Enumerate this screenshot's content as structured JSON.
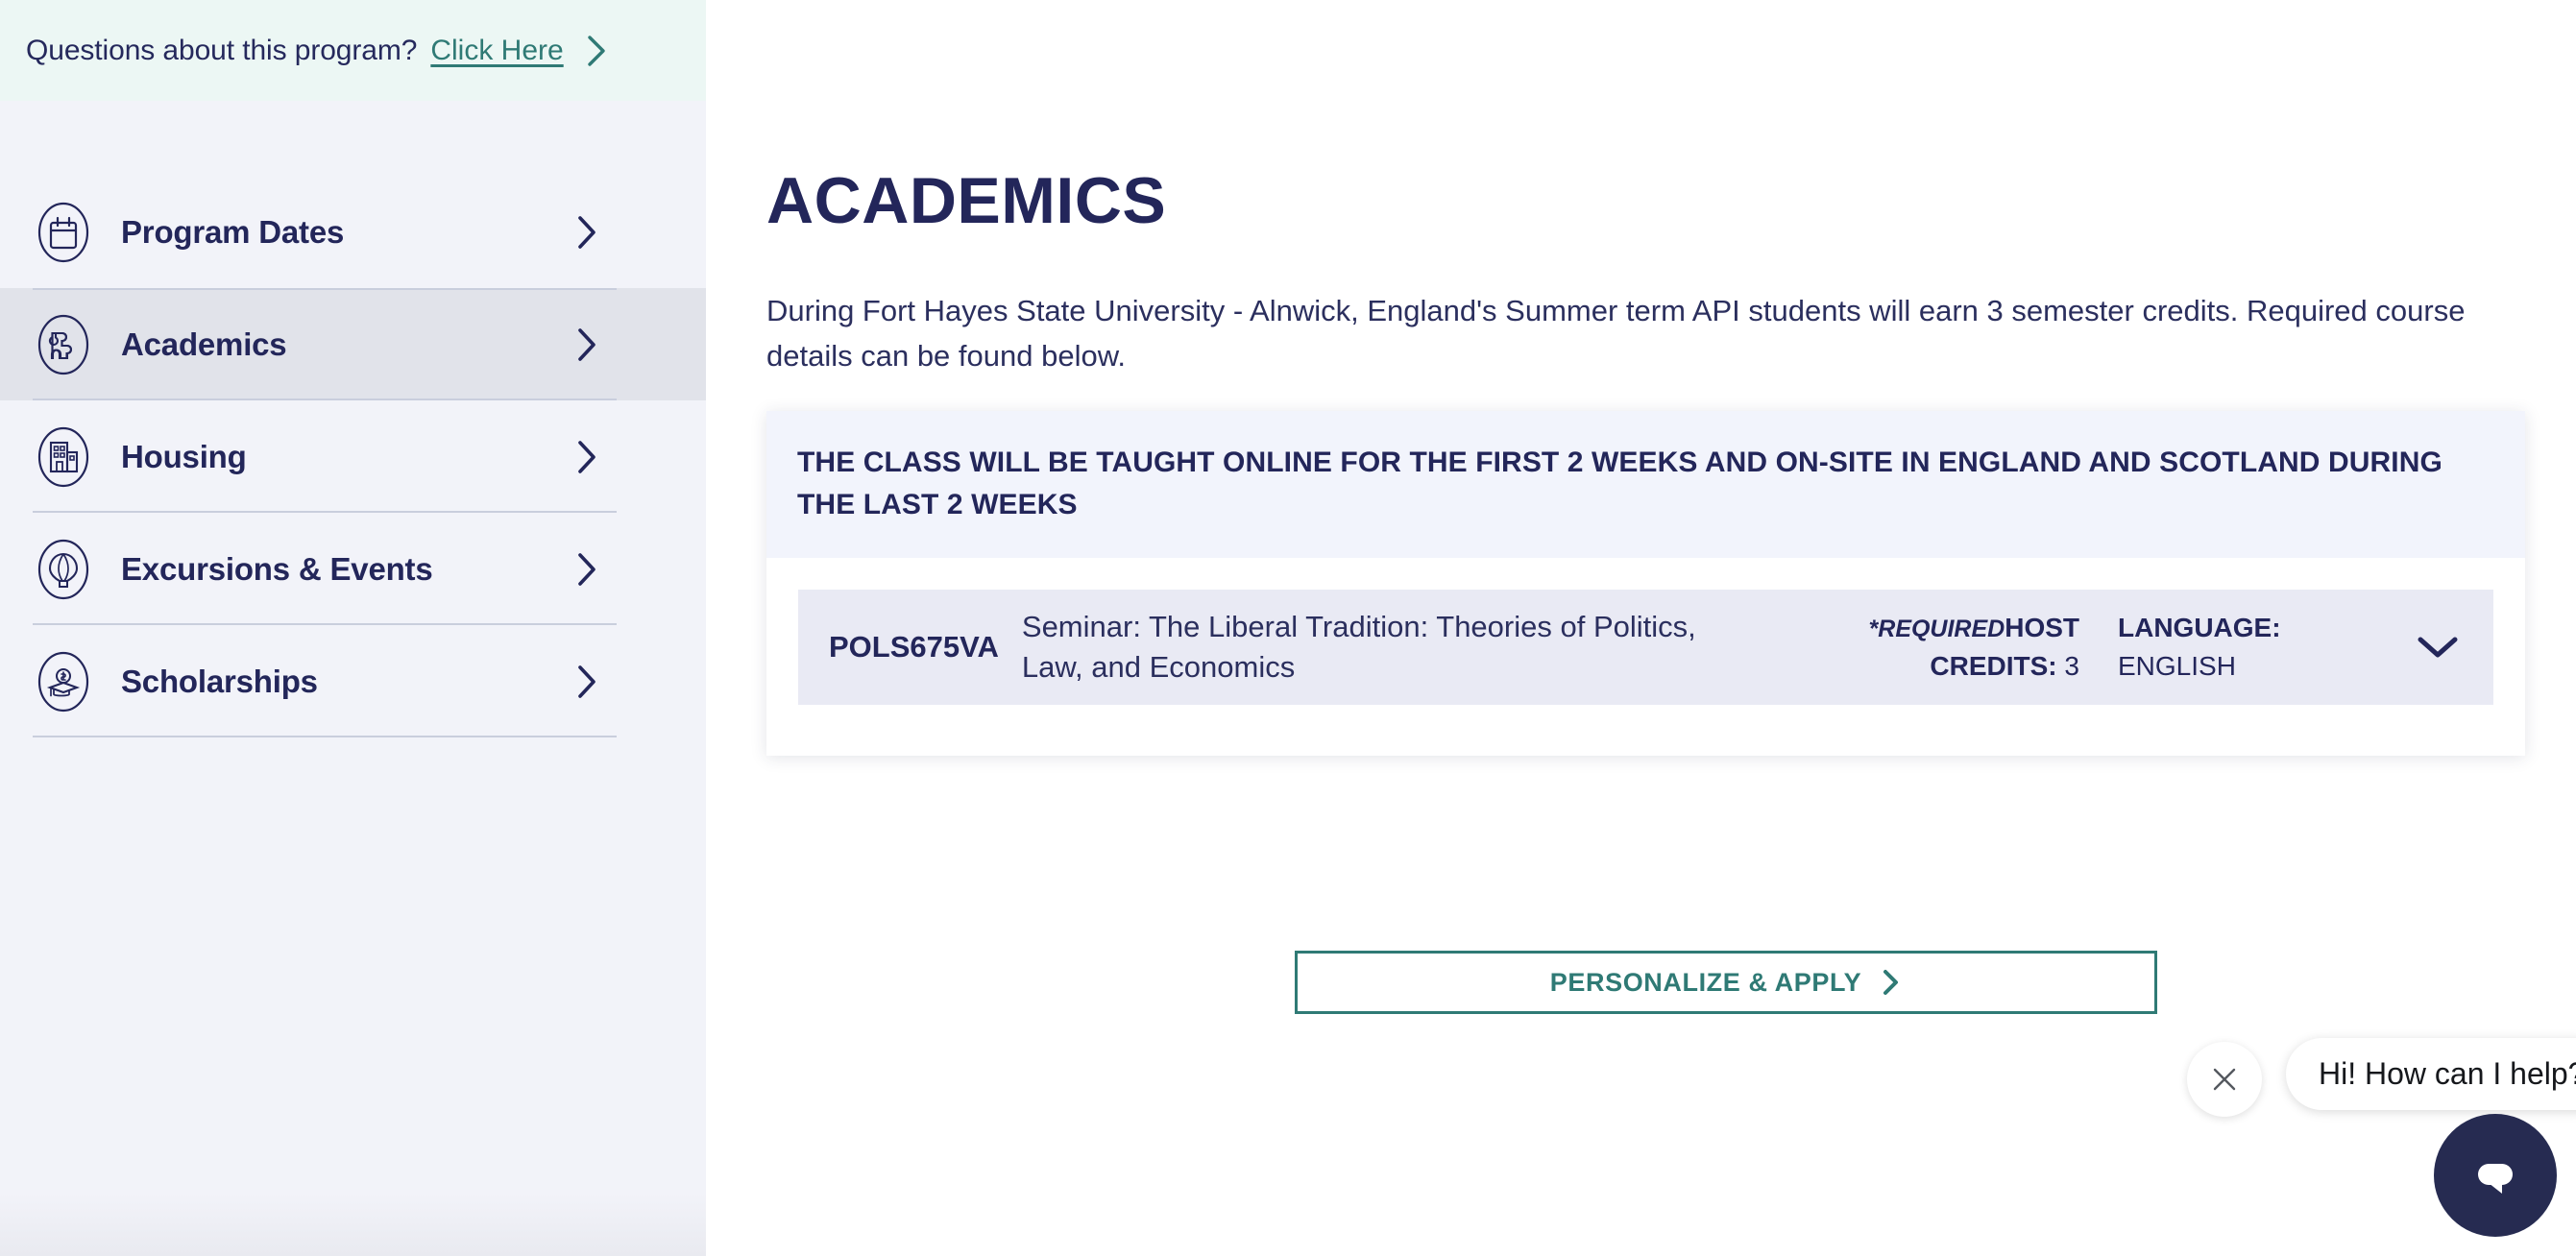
{
  "topbar": {
    "question": "Questions about this program?",
    "link_label": "Click Here",
    "chevron_icon": "chevron-right-icon",
    "bg_color": "#ECF7F4",
    "link_color": "#2F7A75"
  },
  "sidebar": {
    "bg_color": "#F2F3F9",
    "active_bg_color": "#E1E3EA",
    "items": [
      {
        "label": "Program Dates",
        "icon": "calendar-icon",
        "chevron_icon": "chevron-right-icon",
        "active": false
      },
      {
        "label": "Academics",
        "icon": "puzzle-piece-icon",
        "chevron_icon": "chevron-right-icon",
        "active": true
      },
      {
        "label": "Housing",
        "icon": "building-icon",
        "chevron_icon": "chevron-right-icon",
        "active": false
      },
      {
        "label": "Excursions & Events",
        "icon": "hot-air-balloon-icon",
        "chevron_icon": "chevron-right-icon",
        "active": false
      },
      {
        "label": "Scholarships",
        "icon": "graduation-cap-money-icon",
        "chevron_icon": "chevron-right-icon",
        "active": false
      }
    ]
  },
  "main": {
    "title": "ACADEMICS",
    "intro": "During Fort Hayes State University - Alnwick, England's Summer term API students will earn 3 semester credits. Required course details can be found below.",
    "banner": {
      "text": "THE CLASS WILL BE TAUGHT ONLINE FOR THE FIRST 2 WEEKS AND ON-SITE IN ENGLAND AND SCOTLAND DURING THE LAST 2 WEEKS",
      "bg_color": "#F2F4FC"
    },
    "course": {
      "code": "POLS675VA",
      "title": "Seminar: The Liberal Tradition: Theories of Politics, Law, and Economics",
      "required_note": "*REQUIRED",
      "credits_label": "HOST CREDITS:",
      "credits_value": "3",
      "language_label": "LANGUAGE:",
      "language_value": "ENGLISH",
      "expand_icon": "chevron-down-icon",
      "bg_color": "#E9EAF4"
    },
    "apply_button": {
      "label": "PERSONALIZE & APPLY",
      "chevron_icon": "chevron-right-icon",
      "border_color": "#2F7A75"
    }
  },
  "chat": {
    "greeting": "Hi! How can I help?",
    "close_icon": "close-x-icon",
    "launcher_icon": "message-bubble-icon",
    "launcher_color": "#262B51"
  }
}
